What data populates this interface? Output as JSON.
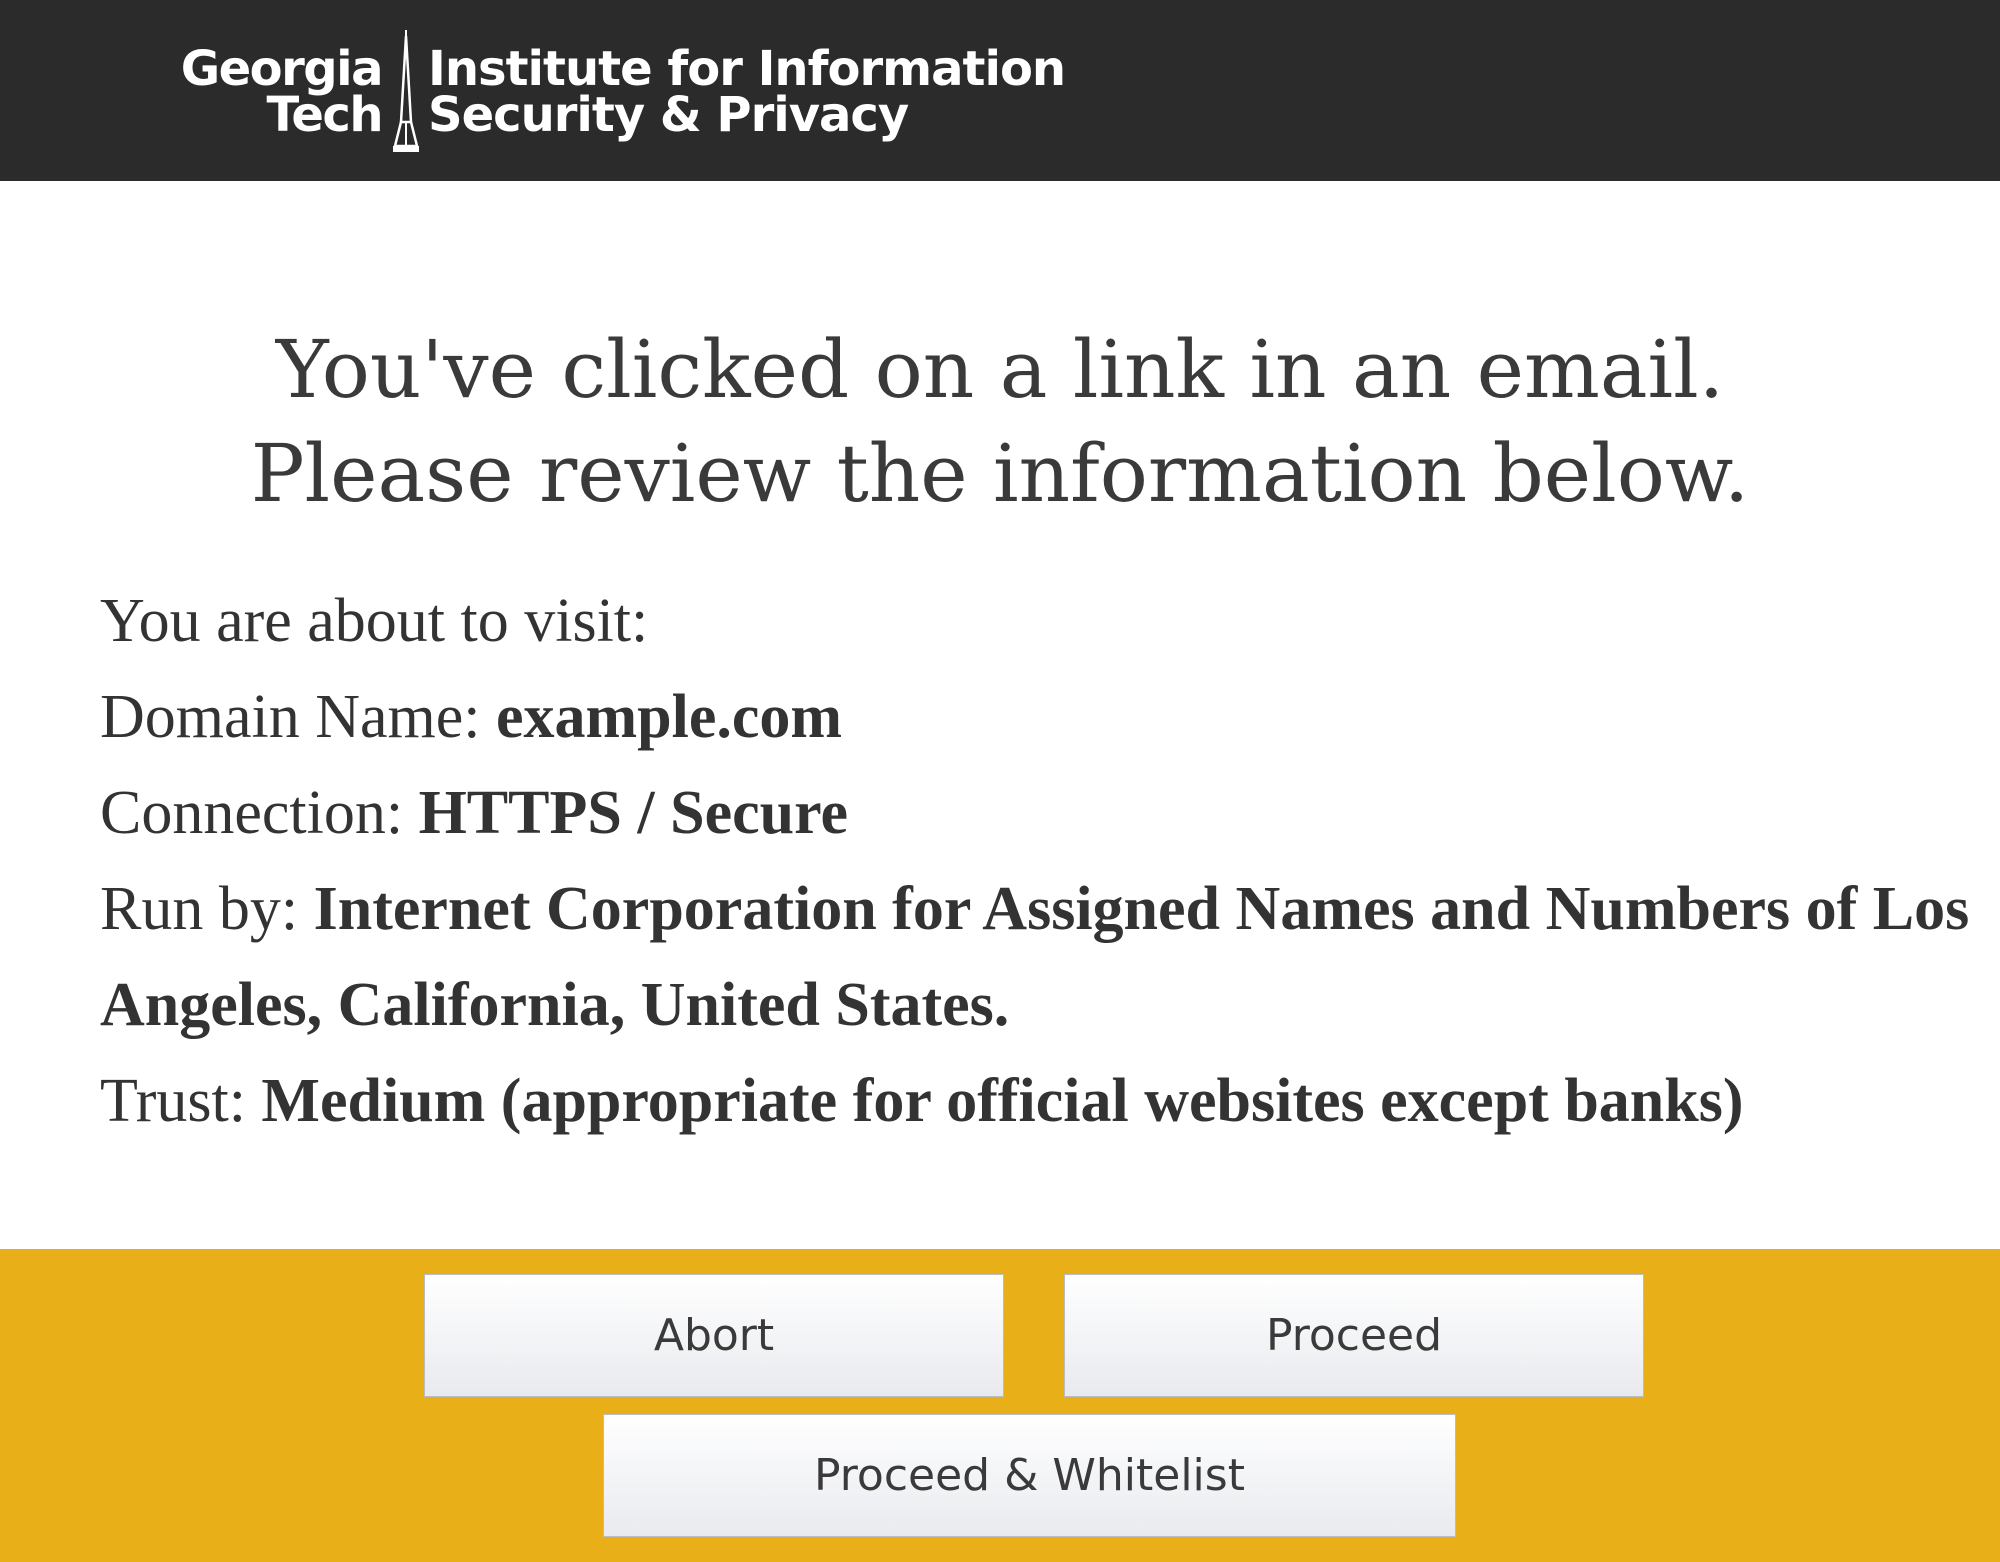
{
  "header": {
    "logo": {
      "gt_line1": "Georgia",
      "gt_line2": "Tech",
      "inst_line1": "Institute for Information",
      "inst_line2": "Security & Privacy",
      "spire_icon": "tech-tower-spire-icon"
    },
    "background_color": "#2b2b2b"
  },
  "headline": {
    "line1": "You've clicked on a link in an email.",
    "line2": "Please review the information below."
  },
  "info": {
    "intro": "You are about to visit:",
    "domain_label": "Domain Name: ",
    "domain_value": "example.com",
    "connection_label": "Connection: ",
    "connection_value": "HTTPS / Secure",
    "runby_label": "Run by: ",
    "runby_value": "Internet Corporation for Assigned Names and Numbers of Los Angeles, California, United States.",
    "trust_label": "Trust: ",
    "trust_value": "Medium (appropriate for official websites except banks)"
  },
  "actions": {
    "abort": "Abort",
    "proceed": "Proceed",
    "proceed_whitelist": "Proceed & Whitelist",
    "footer_color": "#e9af18"
  }
}
